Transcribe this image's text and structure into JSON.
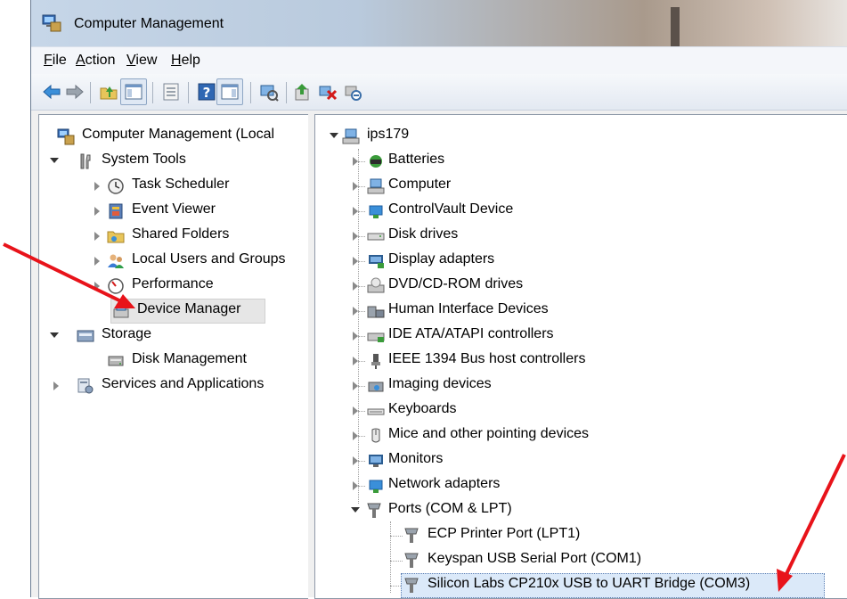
{
  "window": {
    "title": "Computer Management"
  },
  "menu": [
    {
      "label": "File",
      "acc": "F",
      "rest": "ile"
    },
    {
      "label": "Action",
      "acc": "A",
      "rest": "ction"
    },
    {
      "label": "View",
      "acc": "V",
      "rest": "iew"
    },
    {
      "label": "Help",
      "acc": "H",
      "rest": "elp"
    }
  ],
  "toolbar_icons": [
    "back-arrow-icon",
    "forward-arrow-icon",
    "up-folder-icon",
    "show-hide-console-tree-icon",
    "properties-icon",
    "help-icon",
    "show-action-pane-icon",
    "scan-hardware-icon",
    "update-driver-icon",
    "uninstall-icon",
    "disable-icon"
  ],
  "left_tree": {
    "root": "Computer Management (Local",
    "system_tools": "System Tools",
    "task_scheduler": "Task Scheduler",
    "event_viewer": "Event Viewer",
    "shared_folders": "Shared Folders",
    "local_users": "Local Users and Groups",
    "performance": "Performance",
    "device_manager": "Device Manager",
    "storage": "Storage",
    "disk_management": "Disk Management",
    "services": "Services and Applications"
  },
  "device_tree": {
    "computer_name": "ips179",
    "categories": [
      "Batteries",
      "Computer",
      "ControlVault Device",
      "Disk drives",
      "Display adapters",
      "DVD/CD-ROM drives",
      "Human Interface Devices",
      "IDE ATA/ATAPI controllers",
      "IEEE 1394 Bus host controllers",
      "Imaging devices",
      "Keyboards",
      "Mice and other pointing devices",
      "Monitors",
      "Network adapters"
    ],
    "ports_label": "Ports (COM & LPT)",
    "ports": [
      "ECP Printer Port (LPT1)",
      "Keyspan USB Serial Port (COM1)",
      "Silicon Labs CP210x USB to UART Bridge (COM3)"
    ]
  },
  "colors": {
    "annotation_arrow": "#e8131a",
    "selection": "#dbe9f9"
  }
}
